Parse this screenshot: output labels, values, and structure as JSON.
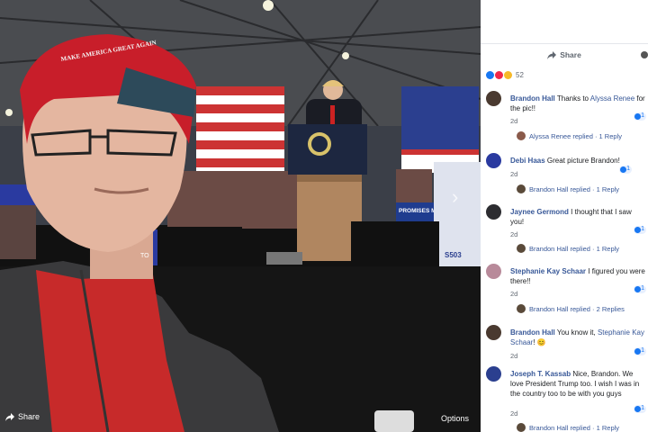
{
  "viewer": {
    "share_label": "Share",
    "options_label": "Options",
    "next_icon": "chevron-right-icon",
    "scene_text": {
      "hat_text": "MAKE AMERICA GREAT AGAIN",
      "sign_text": "PROMISES MADE",
      "side_text": "TO",
      "side_text2": "S503"
    }
  },
  "panel": {
    "share_label": "Share",
    "reaction_count": "52",
    "colors": {
      "link": "#385898",
      "like": "#1877f2"
    },
    "comments": [
      {
        "name": "Brandon Hall",
        "text": "Thanks to ",
        "mention": "Alyssa Renee",
        "text_after": " for the pic!!",
        "time": "2d",
        "likes": "1",
        "reply_label": "Alyssa Renee replied · 1 Reply"
      },
      {
        "name": "Debi Haas",
        "text": "Great picture Brandon!",
        "time": "2d",
        "likes": "1",
        "reply_label": "Brandon Hall replied · 1 Reply"
      },
      {
        "name": "Jaynee Germond",
        "text": "I thought that I saw you!",
        "time": "2d",
        "likes": "1",
        "reply_label": "Brandon Hall replied · 1 Reply"
      },
      {
        "name": "Stephanie Kay Schaar",
        "text": "I figured you were there!!",
        "time": "2d",
        "likes": "1",
        "reply_label": "Brandon Hall replied · 2 Replies"
      },
      {
        "name": "Brandon Hall",
        "text": "You know it, ",
        "mention": "Stephanie Kay Schaar",
        "text_after": "! 😊",
        "time": "2d",
        "likes": "1"
      },
      {
        "name": "Joseph T. Kassab",
        "text": "Nice, Brandon. We love President Trump too. I wish I was in the country too to be with you guys",
        "time": "2d",
        "likes": "1",
        "reply_label": "Brandon Hall replied · 1 Reply"
      }
    ]
  }
}
